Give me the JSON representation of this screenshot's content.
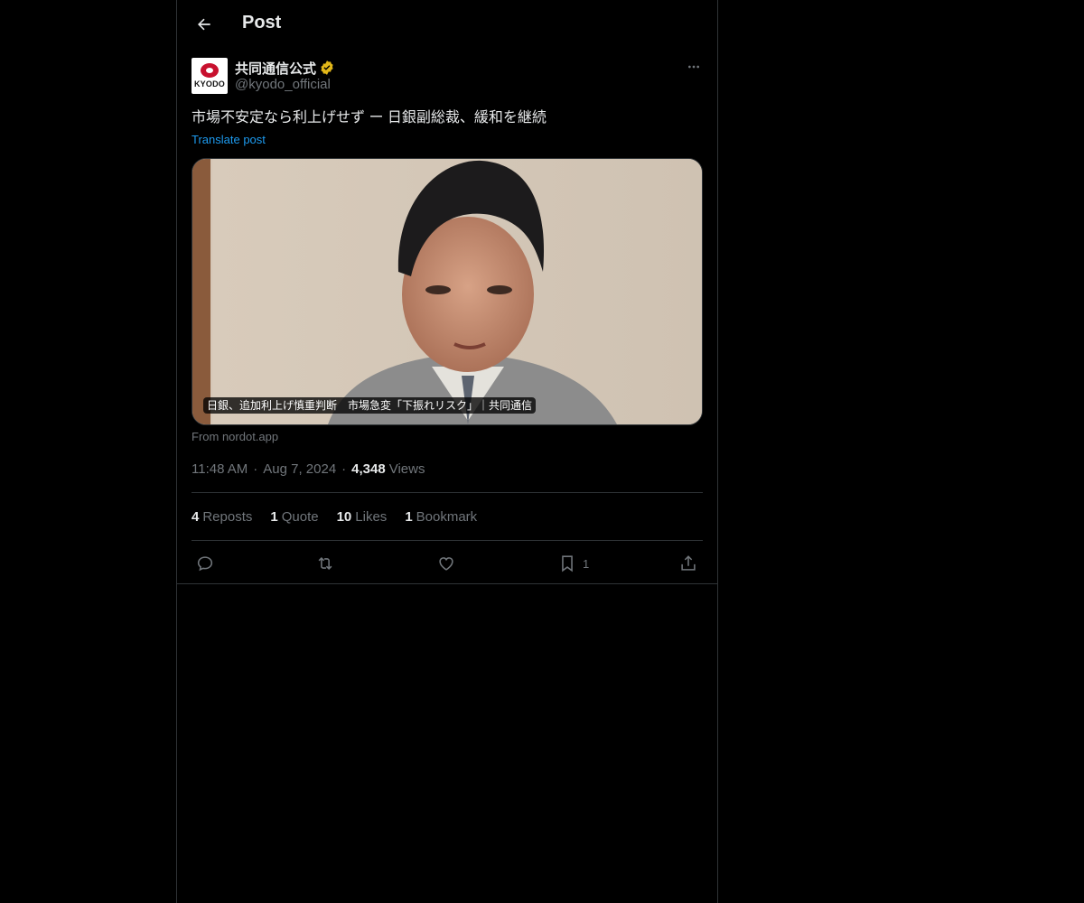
{
  "header": {
    "title": "Post",
    "back_icon": "arrow-left-icon"
  },
  "author": {
    "display_name": "共同通信公式",
    "handle": "@kyodo_official",
    "avatar_text": "KYODO",
    "verified_icon": "verified-badge-icon",
    "verified_color": "#e2b719",
    "brand_color": "#c8102e"
  },
  "post": {
    "text": "市場不安定なら利上げせず ー 日銀副総裁、緩和を継続",
    "translate_label": "Translate post",
    "card_title": "日銀、追加利上げ慎重判断　市場急変「下振れリスク」｜共同通信",
    "card_source": "From nordot.app",
    "time": "11:48 AM",
    "date": "Aug 7, 2024",
    "views_count": "4,348",
    "views_label": "Views"
  },
  "stats": {
    "reposts_count": "4",
    "reposts_label": "Reposts",
    "quotes_count": "1",
    "quotes_label": "Quote",
    "likes_count": "10",
    "likes_label": "Likes",
    "bookmarks_count": "1",
    "bookmarks_label": "Bookmark"
  },
  "actions": {
    "reply_icon": "reply-icon",
    "repost_icon": "repost-icon",
    "like_icon": "heart-icon",
    "bookmark_icon": "bookmark-icon",
    "bookmark_count": "1",
    "share_icon": "share-icon"
  },
  "colors": {
    "accent": "#1d9bf0",
    "background": "#000000",
    "border": "#2f3336",
    "secondary_text": "#71767b"
  }
}
